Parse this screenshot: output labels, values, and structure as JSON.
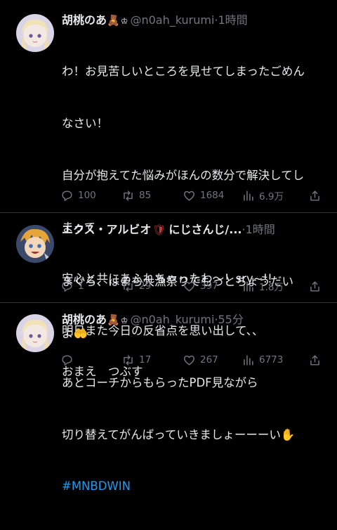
{
  "tweets": [
    {
      "display_name": "胡桃のあ",
      "badge_emoji": "🧸",
      "handle": "@n0ah_kurumi",
      "separator": "·",
      "time": "1時間",
      "text_lines": [
        "わ！お見苦しいところを見せてしまったごめん",
        "なさい！",
        "自分が抱えてた悩みがほんの数分で解決してし",
        "まって",
        "安心と共にあふれちゃったわ〜！sry~!!",
        "明日また今日の反省点を思い出して、、",
        "あとコーチからもらったPDF見ながら",
        "切り替えてがんばっていきましょーーーい✋"
      ],
      "hashtag": "#MNBDWIN",
      "replies": "100",
      "retweets": "85",
      "likes": "1684",
      "views": "6.9万"
    },
    {
      "display_name": "エクス・アルビオ",
      "badge_emoji": "🛡",
      "handle": "にじさんじ/...",
      "separator": "·",
      "time": "1時間",
      "text_lines": [
        "まぐろ、はまち大漁祭りでもっとちょうだい",
        "よ🤲"
      ],
      "replies": "1",
      "retweets": "29",
      "likes": "397",
      "views": "1.8万"
    },
    {
      "display_name": "胡桃のあ",
      "badge_emoji": "🧸",
      "handle": "@n0ah_kurumi",
      "separator": "·",
      "time": "55分",
      "text_lines": [
        "おまえ　つぶす"
      ],
      "replies": "",
      "retweets": "17",
      "likes": "267",
      "views": "6773"
    }
  ],
  "colors": {
    "background": "#000000",
    "text": "#e7e9ea",
    "muted": "#71767b",
    "link": "#1d9bf0",
    "divider": "#2f3336"
  },
  "icons": [
    "reply-icon",
    "retweet-icon",
    "like-icon",
    "views-icon",
    "share-icon",
    "crown-icon"
  ]
}
